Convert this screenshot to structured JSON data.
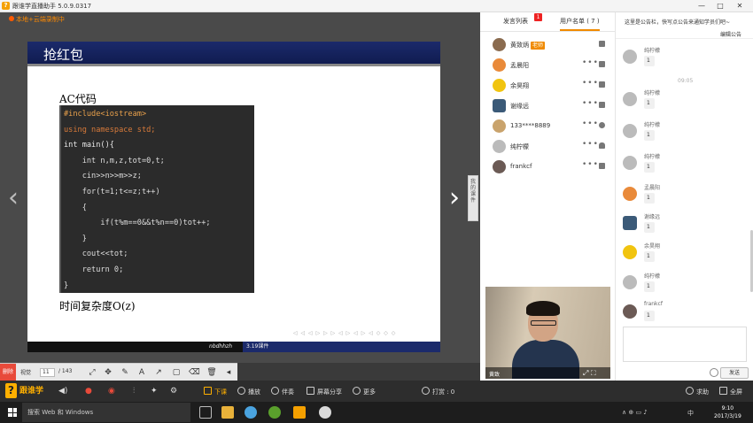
{
  "window": {
    "title": "跟谁学直播助手 5.0.9.0317",
    "logo_glyph": "?",
    "minimize": "—",
    "maximize": "□",
    "close": "✕"
  },
  "recording": {
    "status": "本地+云端录制中"
  },
  "slide": {
    "title": "抢红包",
    "ac_label": "AC代码",
    "code_lines": [
      "#include<iostream>",
      "using namespace std;",
      "int main(){",
      "    int n,m,z,tot=0,t;",
      "    cin>>n>>m>>z;",
      "    for(t=1;t<=z;t++)",
      "    {",
      "        if(t%m==0&&t%n==0)tot++;",
      "    }",
      "    cout<<tot;",
      "    return 0;",
      "}"
    ],
    "complexity": "时间复杂度O(z)",
    "footer_author": "nbdhhzh",
    "footer_section": "3.19课件",
    "nav_dots": "◁ ◁ ◁ ▷ ▷ ▷ ◁ ▷ ◁ ▷ ◁ ◇ ◇ ◇",
    "prev_glyph": "‹",
    "next_glyph": "›"
  },
  "tools": {
    "delete_label": "删除",
    "page_label": "视觉",
    "page_current": "11",
    "page_total": "/ 143",
    "tool_glyphs": [
      "⤢",
      "✥",
      "✎",
      "A",
      "↗",
      "▢",
      "⌫",
      "🗑",
      "◂"
    ]
  },
  "sidetab": {
    "label": "我的课件"
  },
  "panel": {
    "tab_speakers": "发言列表",
    "tab_users": "用户名单 ( 7 )",
    "speakers_badge": "1",
    "users": [
      {
        "name": "黄致炳",
        "tag": "老师",
        "dots": "",
        "os": "windows"
      },
      {
        "name": "孟晨阳",
        "tag": "",
        "dots": "•••",
        "os": "windows"
      },
      {
        "name": "余昊翔",
        "tag": "",
        "dots": "•••",
        "os": "windows"
      },
      {
        "name": "谢缘远",
        "tag": "",
        "dots": "•••",
        "os": "windows"
      },
      {
        "name": "133****8889",
        "tag": "",
        "dots": "•••",
        "os": "apple"
      },
      {
        "name": "纯柠檬",
        "tag": "",
        "dots": "•••",
        "os": "android"
      },
      {
        "name": "frankcf",
        "tag": "",
        "dots": "•••",
        "os": "windows"
      }
    ]
  },
  "webcam": {
    "name": "黄致",
    "controls": "⤢  ⛶"
  },
  "chat": {
    "announcement": "这里是公告栏，快写点公告来通知学员们吧~",
    "announcement_button": "编辑公告",
    "timestamp": "09:05",
    "messages": [
      {
        "name": "纯柠檬",
        "text": "1"
      },
      {
        "name": "纯柠檬",
        "text": "1"
      },
      {
        "name": "纯柠檬",
        "text": "1"
      },
      {
        "name": "纯柠檬",
        "text": "1"
      },
      {
        "name": "孟晨阳",
        "text": "1"
      },
      {
        "name": "谢缘远",
        "text": "1"
      },
      {
        "name": "余昊翔",
        "text": "1"
      },
      {
        "name": "纯柠檬",
        "text": "1"
      },
      {
        "name": "frankcf",
        "text": "1"
      }
    ],
    "send_label": "发送"
  },
  "apptool": {
    "brand": "跟谁学",
    "items": [
      {
        "label": "下课"
      },
      {
        "label": "播放"
      },
      {
        "label": "伴奏"
      },
      {
        "label": "屏幕分享"
      },
      {
        "label": "更多"
      }
    ],
    "likes": "打赏 : 0",
    "help": "求助",
    "fullscreen": "全屏"
  },
  "taskbar": {
    "search_placeholder": "搜索 Web 和 Windows",
    "time": "9:10",
    "date": "2017/3/19",
    "ime": "中",
    "tray_icons": "∧  ⊕  ▭  ♪"
  },
  "colors": {
    "accent": "#f08a00",
    "slide_header": "#1b2a6b",
    "code_bg": "#2b2b2b",
    "recording": "#ff5a00"
  }
}
